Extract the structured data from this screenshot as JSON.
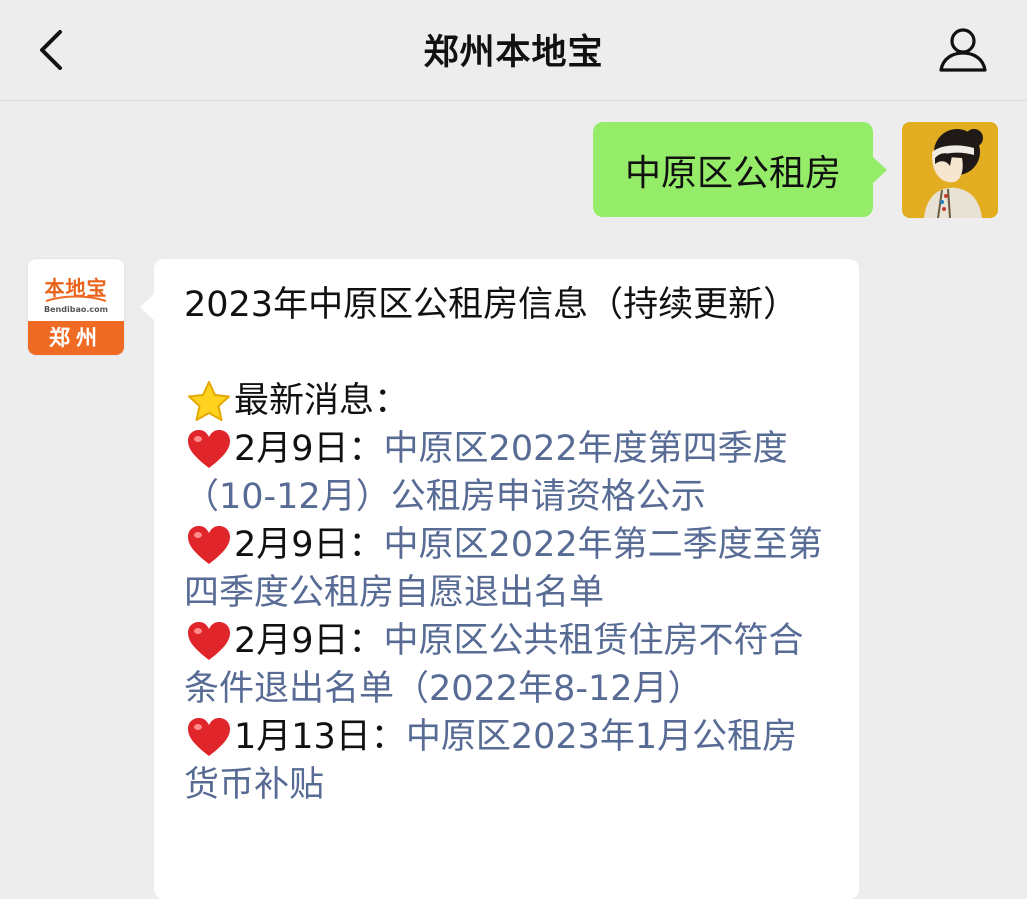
{
  "header": {
    "title": "郑州本地宝"
  },
  "conversation": {
    "outgoing": {
      "text": "中原区公租房"
    },
    "incoming": {
      "bot_logo": {
        "brand": "本地宝",
        "url": "Bendibao.com",
        "city": "郑州"
      },
      "headline": "2023年中原区公租房信息（持续更新）",
      "section_title": "最新消息：",
      "items": [
        {
          "date": "2月9日：",
          "link": "中原区2022年度第四季度（10-12月）公租房申请资格公示"
        },
        {
          "date": "2月9日：",
          "link": "中原区2022年第二季度至第四季度公租房自愿退出名单"
        },
        {
          "date": "2月9日：",
          "link": "中原区公共租赁住房不符合条件退出名单（2022年8-12月）"
        },
        {
          "date": "1月13日：",
          "link": "中原区2023年1月公租房货币补贴"
        }
      ]
    }
  },
  "icons": {
    "back": "chevron-left-icon",
    "profile": "person-icon",
    "star": "star-icon",
    "heart": "heart-icon"
  },
  "colors": {
    "background": "#ededed",
    "outgoing_bubble": "#95ec69",
    "incoming_bubble": "#ffffff",
    "link": "#576b95",
    "brand_orange": "#ef6b23"
  }
}
